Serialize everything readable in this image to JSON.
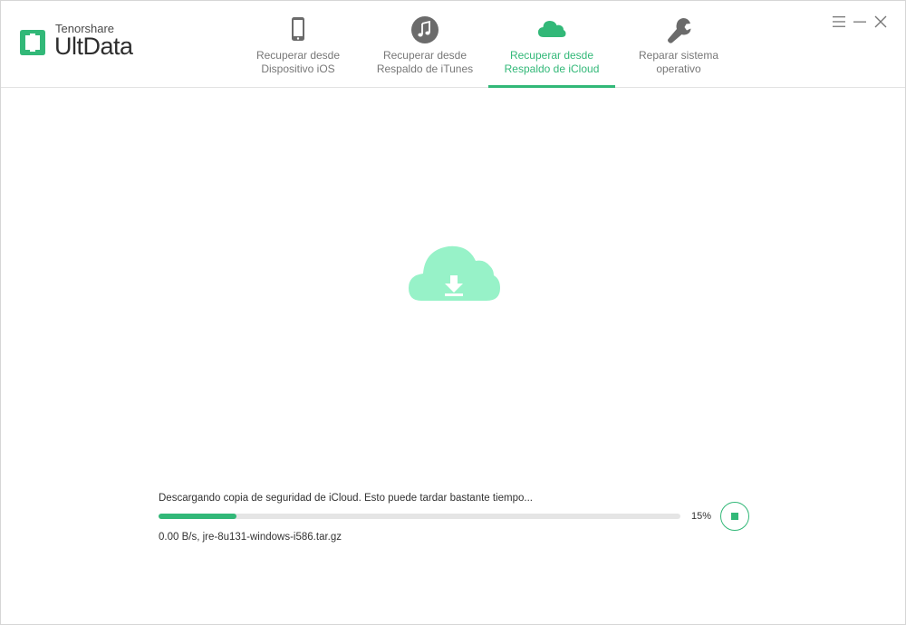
{
  "app": {
    "brand": "Tenorshare",
    "product": "UltData",
    "accent_color": "#32b878"
  },
  "tabs": [
    {
      "line1": "Recuperar desde",
      "line2": "Dispositivo iOS",
      "icon": "phone-icon",
      "active": false
    },
    {
      "line1": "Recuperar desde",
      "line2": "Respaldo de iTunes",
      "icon": "itunes-music-icon",
      "active": false
    },
    {
      "line1": "Recuperar desde",
      "line2": "Respaldo de iCloud",
      "icon": "cloud-icon",
      "active": true
    },
    {
      "line1": "Reparar sistema",
      "line2": "operativo",
      "icon": "wrench-icon",
      "active": false
    }
  ],
  "window_controls": [
    "menu-icon",
    "minimize-icon",
    "close-icon"
  ],
  "main": {
    "illustration_icon": "cloud-download-icon",
    "status_text": "Descargando copia de seguridad de iCloud. Esto puede tardar bastante tiempo...",
    "progress_fraction": 0.15,
    "percent_text": "15%",
    "file_info": "0.00 B/s, jre-8u131-windows-i586.tar.gz",
    "stop_button_icon": "stop-icon"
  }
}
